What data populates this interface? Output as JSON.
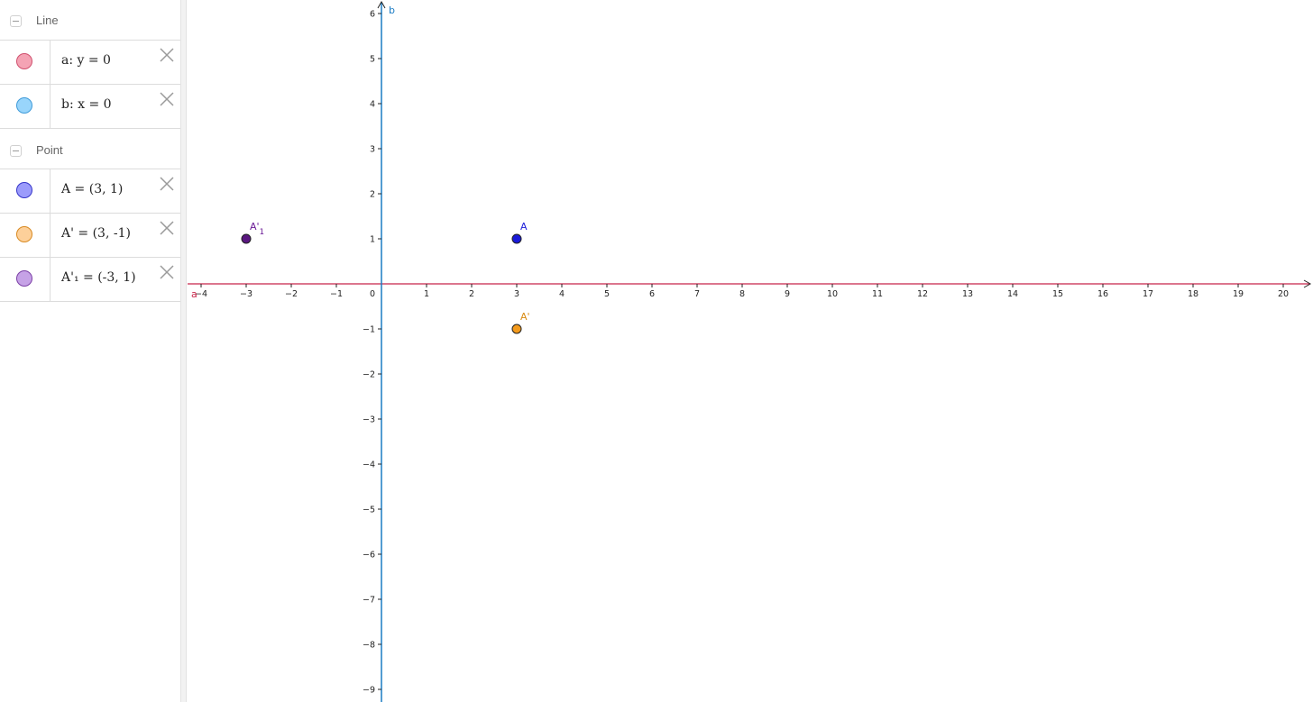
{
  "algebra_view": {
    "groups": [
      {
        "title": "Line",
        "items": [
          {
            "expr": "a: y = 0",
            "marble_fill": "#f4a3b4",
            "marble_stroke": "#d0506e"
          },
          {
            "expr": "b: x = 0",
            "marble_fill": "#99d5fb",
            "marble_stroke": "#3f9bd9"
          }
        ]
      },
      {
        "title": "Point",
        "items": [
          {
            "expr": "A = (3, 1)",
            "marble_fill": "#9b9bfb",
            "marble_stroke": "#3636c9"
          },
          {
            "expr": "A' = (3, -1)",
            "marble_fill": "#fdd09a",
            "marble_stroke": "#d88a22"
          },
          {
            "expr": "A'₁ = (-3, 1)",
            "marble_fill": "#c6a2e6",
            "marble_stroke": "#7b3fa6"
          }
        ]
      }
    ]
  },
  "graphics_view": {
    "x_axis_label": "b",
    "line_a_label": "a",
    "x_tick_labels": [
      "−4",
      "−3",
      "−2",
      "−1",
      "1",
      "2",
      "3",
      "4",
      "5",
      "6",
      "7",
      "8",
      "9",
      "10",
      "11",
      "12",
      "13",
      "14",
      "15",
      "16",
      "17",
      "18",
      "19",
      "20"
    ],
    "y_tick_labels": [
      "6",
      "5",
      "4",
      "3",
      "2",
      "1",
      "−1",
      "−2",
      "−3",
      "−4",
      "−5",
      "−6",
      "−7",
      "−8",
      "−9"
    ],
    "origin_label": "0",
    "colors": {
      "line_a": "#c8254a",
      "axis_y_line": "#1a7bc4",
      "axis_text": "#222222"
    },
    "points": [
      {
        "name": "A",
        "x": 3,
        "y": 1,
        "fill": "#1a1ad9",
        "label_color": "#1a1ad9"
      },
      {
        "name": "A'",
        "x": 3,
        "y": -1,
        "fill": "#f39a1c",
        "label_color": "#d88a10"
      },
      {
        "name": "A'",
        "subscript": "1",
        "x": -3,
        "y": 1,
        "fill": "#5a1780",
        "label_color": "#6a1a96"
      }
    ]
  }
}
